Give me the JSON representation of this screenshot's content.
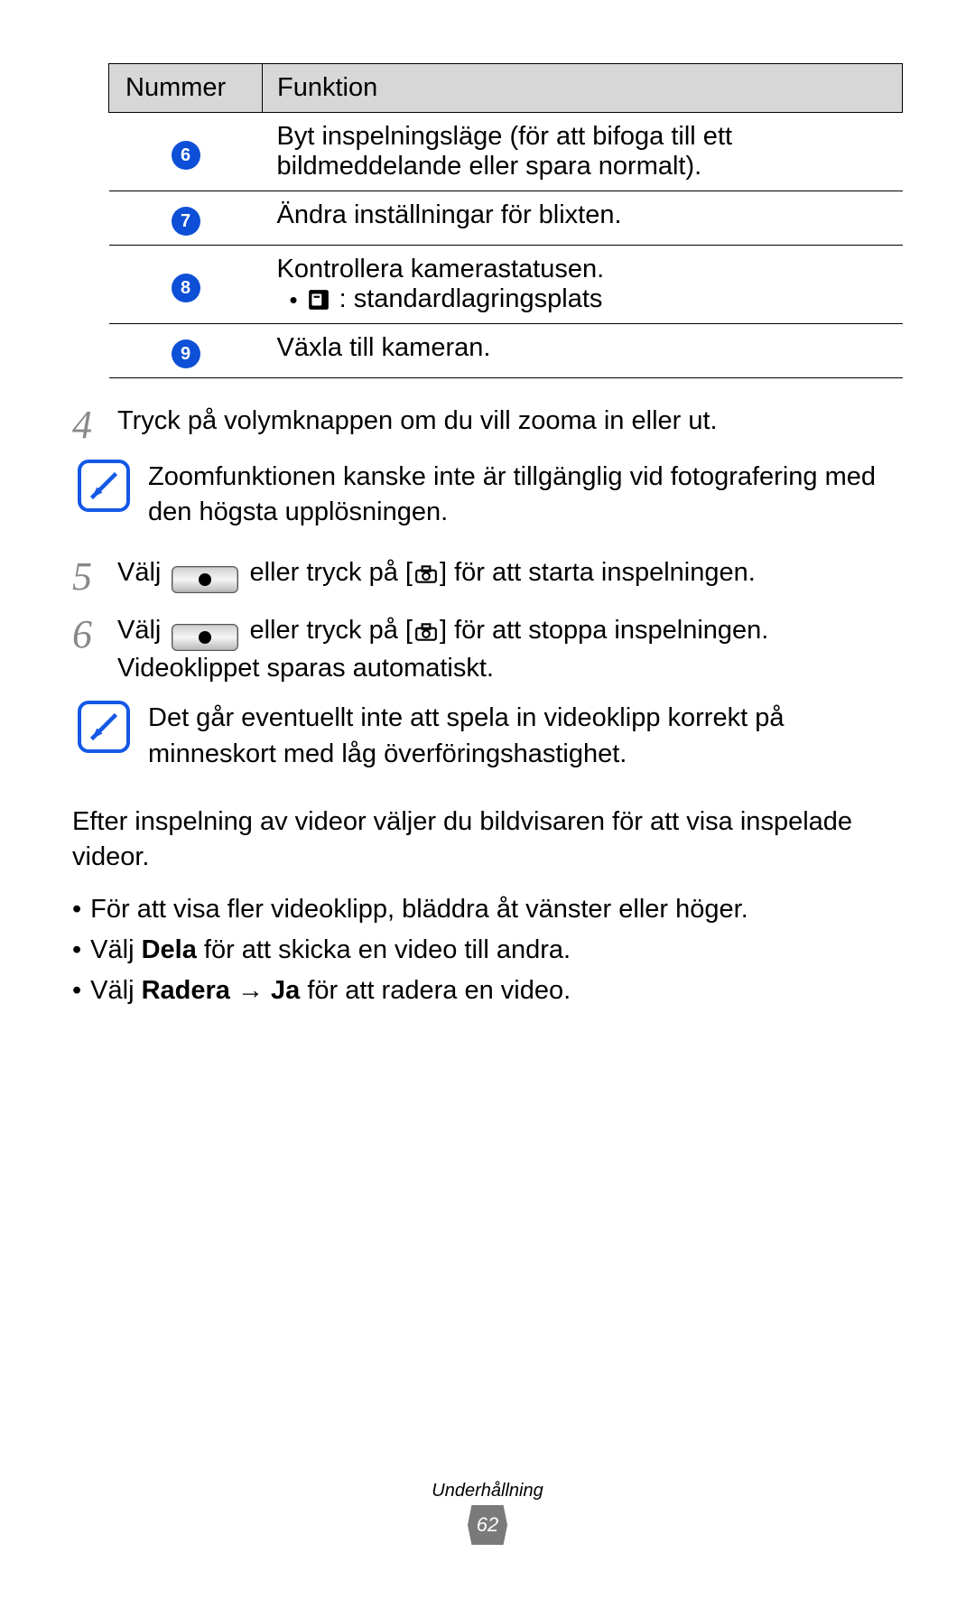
{
  "table": {
    "headers": {
      "num": "Nummer",
      "func": "Funktion"
    },
    "rows": [
      {
        "n": "6",
        "text": "Byt inspelningsläge (för att bifoga till ett bildmeddelande eller spara normalt)."
      },
      {
        "n": "7",
        "text": "Ändra inställningar för blixten."
      },
      {
        "n": "8",
        "text": "Kontrollera kamerastatusen.",
        "bullet": ": standardlagringsplats"
      },
      {
        "n": "9",
        "text": "Växla till kameran."
      }
    ]
  },
  "step4": {
    "n": "4",
    "text": "Tryck på volymknappen om du vill zooma in eller ut."
  },
  "note1": "Zoomfunktionen kanske inte är tillgänglig vid fotografering med den högsta upplösningen.",
  "step5": {
    "n": "5",
    "pre": "Välj",
    "mid": "eller tryck på [",
    "post": "] för att starta inspelningen."
  },
  "step6": {
    "n": "6",
    "pre": "Välj",
    "mid": "eller tryck på [",
    "post1": "] för att stoppa inspelningen.",
    "post2": "Videoklippet sparas automatiskt."
  },
  "note2": "Det går eventuellt inte att spela in videoklipp korrekt på minneskort med låg överföringshastighet.",
  "after_para": "Efter inspelning av videor väljer du bildvisaren för att visa inspelade videor.",
  "bullets": {
    "b1": "För att visa fler videoklipp, bläddra åt vänster eller höger.",
    "b2_pre": "Välj ",
    "b2_bold": "Dela",
    "b2_post": " för att skicka en video till andra.",
    "b3_pre": "Välj ",
    "b3_bold1": "Radera",
    "b3_arrow": " → ",
    "b3_bold2": "Ja",
    "b3_post": " för att radera en video."
  },
  "footer": {
    "category": "Underhållning",
    "page": "62"
  }
}
